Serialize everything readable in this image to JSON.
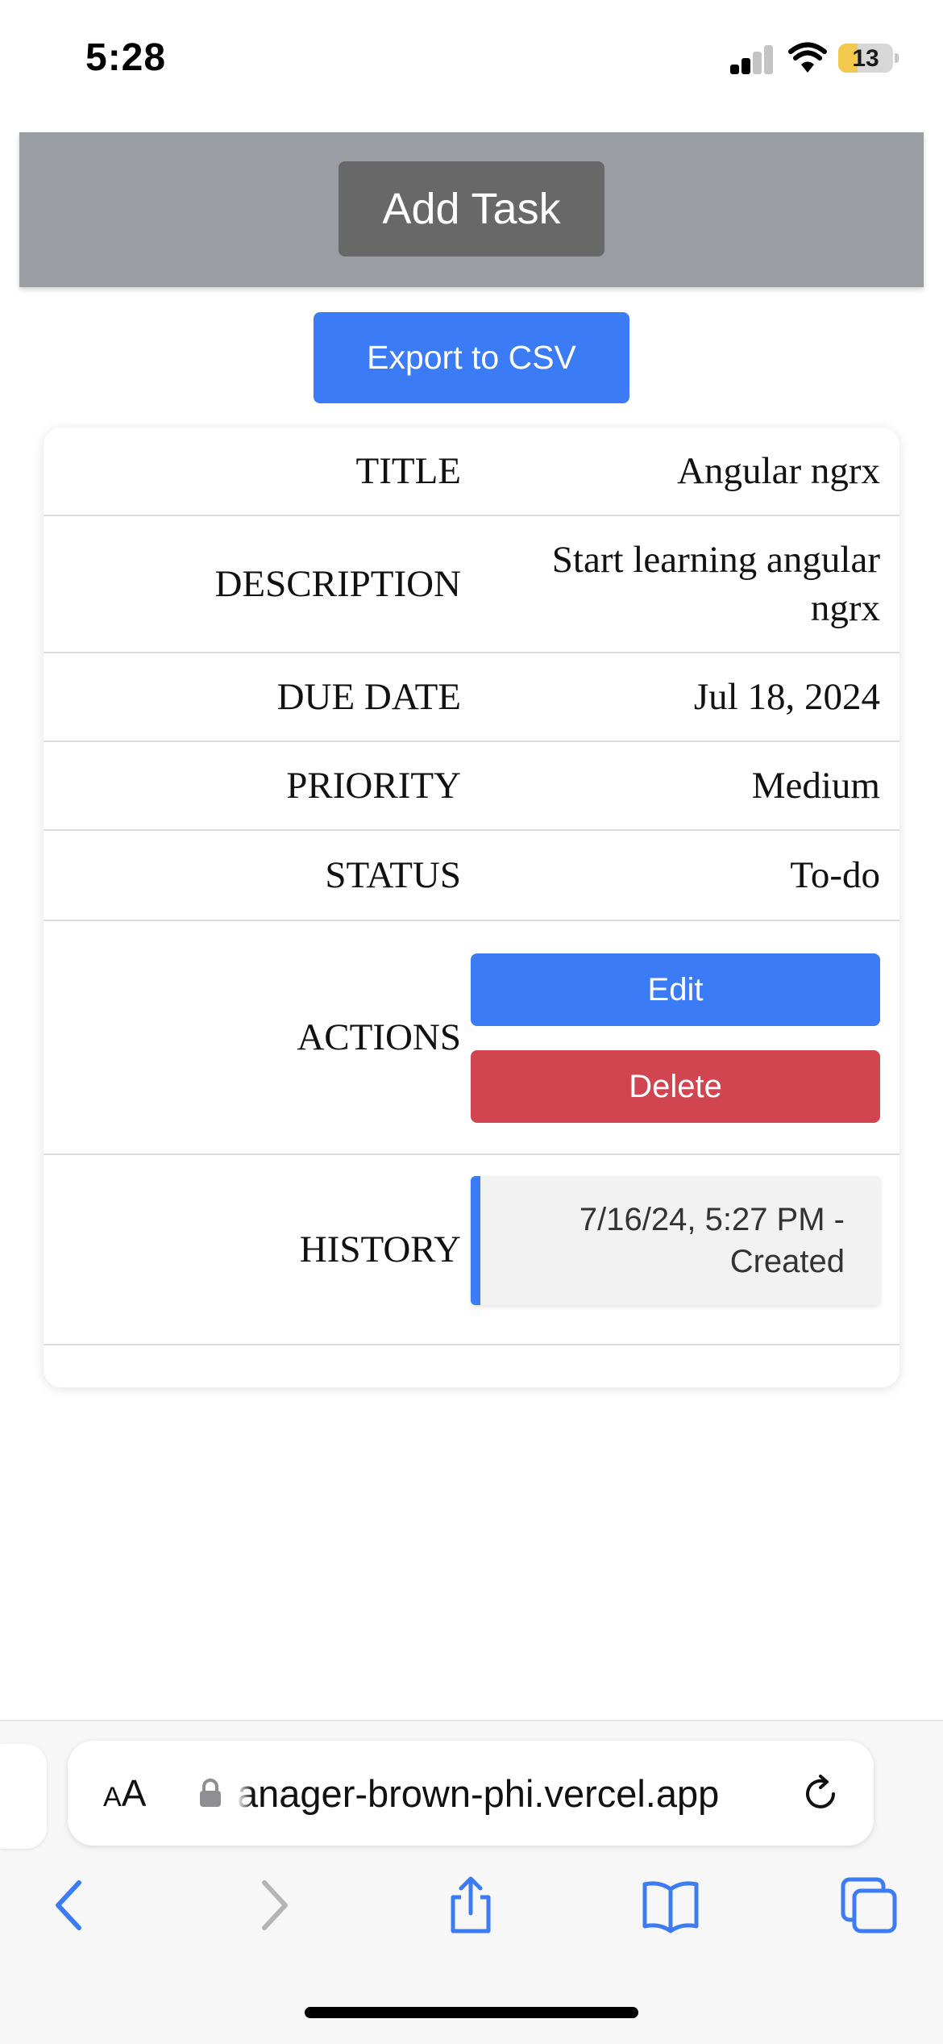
{
  "status_bar": {
    "time": "5:28",
    "battery": "13"
  },
  "header": {
    "add_task_label": "Add Task"
  },
  "toolbar": {
    "export_label": "Export to CSV"
  },
  "task": {
    "title_label": "TITLE",
    "title_value": "Angular ngrx",
    "description_label": "DESCRIPTION",
    "description_value": "Start learning angular ngrx",
    "due_date_label": "DUE DATE",
    "due_date_value": "Jul 18, 2024",
    "priority_label": "PRIORITY",
    "priority_value": "Medium",
    "status_label": "STATUS",
    "status_value": "To-do",
    "actions_label": "ACTIONS",
    "edit_label": "Edit",
    "delete_label": "Delete",
    "history_label": "HISTORY",
    "history_entries": [
      "7/16/24, 5:27 PM - Created"
    ]
  },
  "browser": {
    "text_size_label": "AA",
    "url": "anager-brown-phi.vercel.app"
  },
  "icons": {
    "signal": "cellular-signal-icon",
    "wifi": "wifi-icon",
    "lock": "lock-icon",
    "reload": "reload-icon",
    "back": "chevron-left-icon",
    "forward": "chevron-right-icon",
    "share": "share-icon",
    "bookmarks": "book-icon",
    "tabs": "tabs-icon"
  },
  "colors": {
    "primary": "#3b7bf5",
    "danger": "#d0454f",
    "header_bg": "#9a9ea3",
    "add_task_bg": "#686868"
  }
}
